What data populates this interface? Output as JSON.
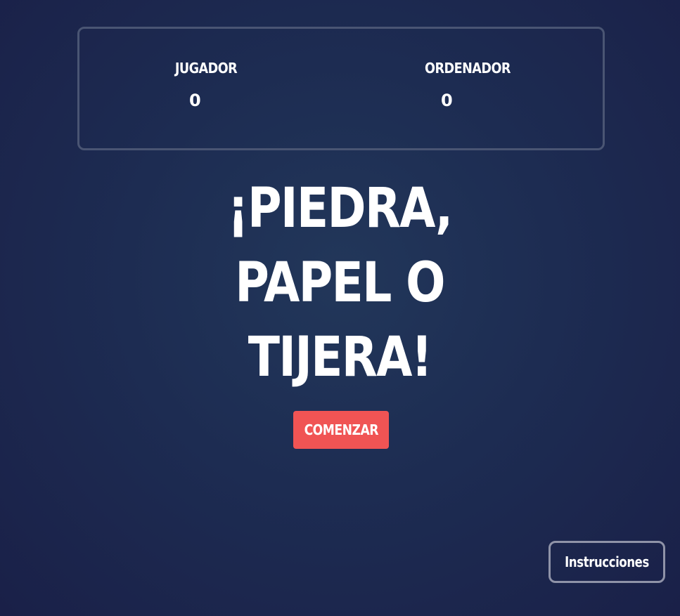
{
  "scoreboard": {
    "player_label": "JUGADOR",
    "player_score": "0",
    "computer_label": "ORDENADOR",
    "computer_score": "0"
  },
  "title": {
    "line1": "¡PIEDRA,",
    "line2": "PAPEL O",
    "line3": "TIJERA!"
  },
  "start_button": {
    "label": "COMENZAR",
    "color": "#f05454"
  },
  "instructions_button": {
    "label": "Instrucciones"
  },
  "colors": {
    "background": "#1d2c52",
    "text": "#ffffff",
    "border": "#4a5573"
  }
}
